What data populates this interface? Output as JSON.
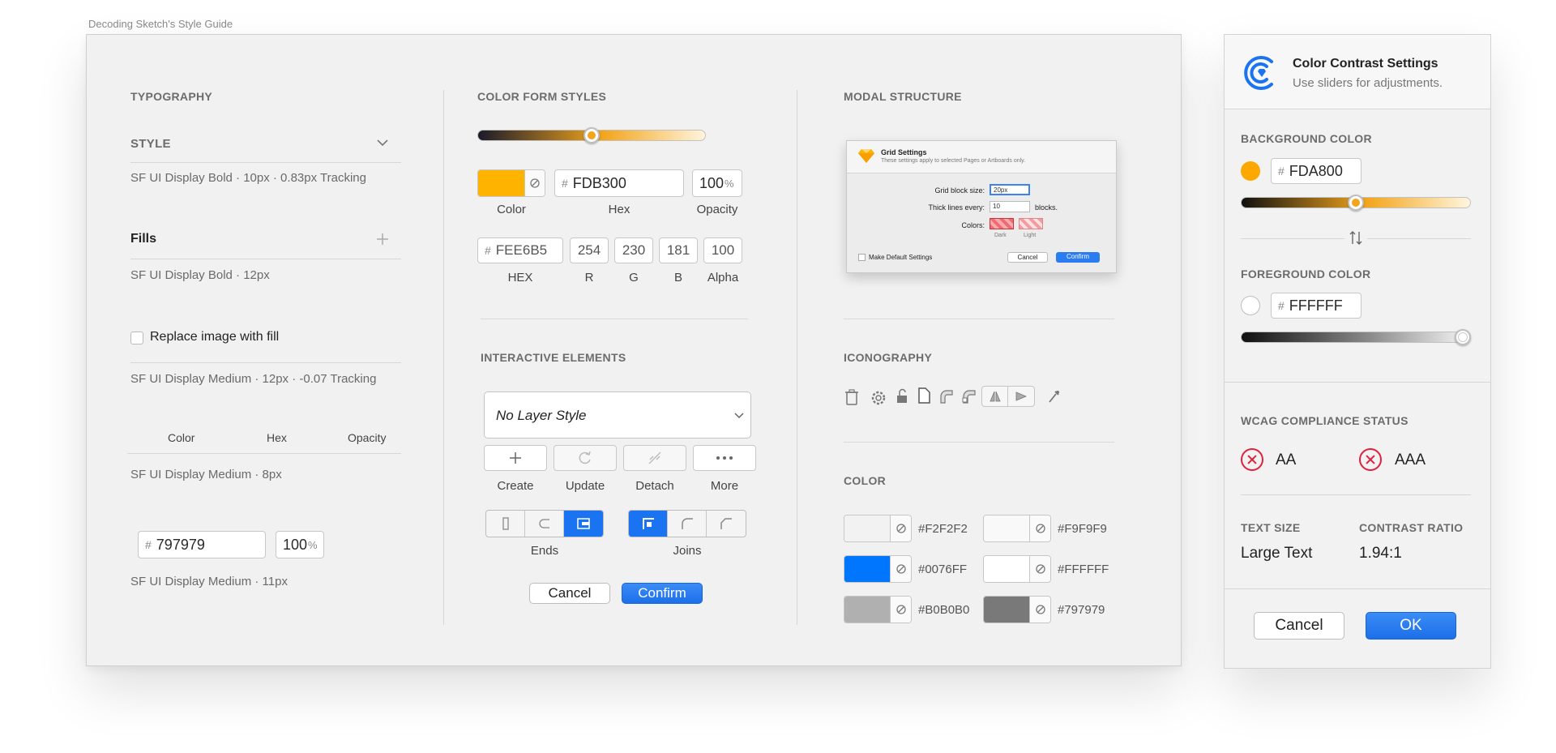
{
  "caption": "Decoding Sketch's Style Guide",
  "typography": {
    "title": "TYPOGRAPHY",
    "style_label": "STYLE",
    "style_note": "SF UI Display Bold · 10px · 0.83px Tracking",
    "fills_label": "Fills",
    "fills_note": "SF UI Display Bold · 12px",
    "replace_label": "Replace image with fill",
    "replace_note": "SF UI Display Medium · 12px · -0.07 Tracking",
    "col_color": "Color",
    "col_hex": "Hex",
    "col_opacity": "Opacity",
    "cols_note": "SF UI Display Medium · 8px",
    "hex_value": "797979",
    "opacity_value": "100",
    "fields_note": "SF UI Display Medium · 11px"
  },
  "color_form": {
    "title": "COLOR FORM STYLES",
    "slider_level": 0.5,
    "swatch_color": "#FDB300",
    "hex_value": "FDB300",
    "opacity_value": "100",
    "label_color": "Color",
    "label_hex": "Hex",
    "label_opacity": "Opacity",
    "hex2_value": "FEE6B5",
    "r": "254",
    "g": "230",
    "b": "181",
    "alpha": "100",
    "label_hex2": "HEX",
    "label_r": "R",
    "label_g": "G",
    "label_b": "B",
    "label_alpha": "Alpha"
  },
  "interactive": {
    "title": "INTERACTIVE ELEMENTS",
    "layer_style": "No Layer Style",
    "create": "Create",
    "update": "Update",
    "detach": "Detach",
    "more": "More",
    "ends": "Ends",
    "joins": "Joins",
    "cancel": "Cancel",
    "confirm": "Confirm"
  },
  "modal": {
    "title": "MODAL STRUCTURE",
    "dlg_title": "Grid Settings",
    "dlg_sub": "These settings apply to selected Pages or Artboards only.",
    "grid_label": "Grid block size:",
    "grid_value": "20px",
    "thick_label": "Thick lines every:",
    "thick_value": "10",
    "thick_suffix": "blocks.",
    "colors_label": "Colors:",
    "dark": "Dark",
    "light": "Light",
    "default_label": "Make Default Settings",
    "cancel": "Cancel",
    "confirm": "Confirm"
  },
  "iconography": {
    "title": "ICONOGRAPHY",
    "icons": [
      "trash-icon",
      "gear-icon",
      "unlock-icon",
      "document-icon",
      "corner-icon",
      "corner-alt-icon",
      "flip-icon",
      "send-icon",
      "eyedropper-icon"
    ]
  },
  "colors": {
    "title": "COLOR",
    "swatches": [
      {
        "hex": "#F2F2F2",
        "color": "#F2F2F2"
      },
      {
        "hex": "#F9F9F9",
        "color": "#F9F9F9"
      },
      {
        "hex": "#0076FF",
        "color": "#0076FF"
      },
      {
        "hex": "#FFFFFF",
        "color": "#FFFFFF"
      },
      {
        "hex": "#B0B0B0",
        "color": "#B0B0B0"
      },
      {
        "hex": "#797979",
        "color": "#797979"
      }
    ]
  },
  "contrast": {
    "title": "Color Contrast Settings",
    "subtitle": "Use sliders for adjustments.",
    "bg_label": "BACKGROUND COLOR",
    "bg_value": "FDA800",
    "bg_color": "#FDA800",
    "bg_level": 0.5,
    "fg_label": "FOREGROUND COLOR",
    "fg_value": "FFFFFF",
    "fg_level": 1.0,
    "wcag_label": "WCAG COMPLIANCE STATUS",
    "aa": "AA",
    "aaa": "AAA",
    "text_size_label": "TEXT SIZE",
    "text_size_value": "Large Text",
    "ratio_label": "CONTRAST RATIO",
    "ratio_value": "1.94:1",
    "cancel": "Cancel",
    "ok": "OK"
  }
}
